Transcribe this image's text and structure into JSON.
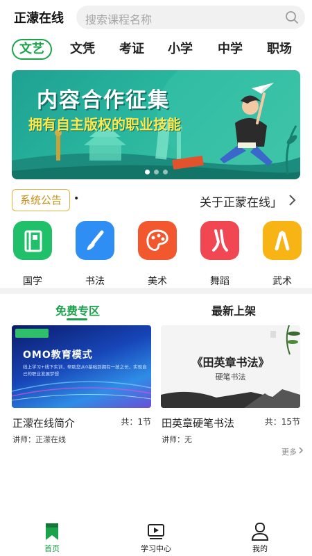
{
  "header": {
    "app_name": "正濛在线",
    "search_placeholder": "搜索课程名称"
  },
  "categories": [
    "文艺",
    "文凭",
    "考证",
    "小学",
    "中学",
    "职场"
  ],
  "active_category": "文艺",
  "banner": {
    "title": "内容合作征集",
    "subtitle": "拥有自主版权的职业技能",
    "slide_count": 3,
    "active_slide": 1
  },
  "notice": {
    "badge": "系统公告",
    "bullet": "•",
    "text": "关于正蒙在线」"
  },
  "subjects": [
    {
      "label": "国学",
      "icon": "book-icon",
      "color": "#20c06a"
    },
    {
      "label": "书法",
      "icon": "brush-icon",
      "color": "#2f8ef3"
    },
    {
      "label": "美术",
      "icon": "palette-icon",
      "color": "#f2572e"
    },
    {
      "label": "舞蹈",
      "icon": "ballet-shoes-icon",
      "color": "#f04752"
    },
    {
      "label": "武术",
      "icon": "nunchaku-icon",
      "color": "#f8b414"
    }
  ],
  "tabs": [
    "免费专区",
    "最新上架"
  ],
  "active_tab": "免费专区",
  "courses": [
    {
      "name": "正濛在线简介",
      "count": "共：1节",
      "teacher": "讲师：正濛在线",
      "thumb_title": "OMO教育模式",
      "thumb_desc": "线上学习+线下实训，帮助您从0基础到拥有一技之长，实现自己的职业发展梦想"
    },
    {
      "name": "田英章硬笔书法",
      "count": "共：15节",
      "teacher": "讲师：无",
      "thumb_title": "《田英章书法》",
      "thumb_sub": "硬笔书法"
    }
  ],
  "more_label": "更多",
  "bottom_nav": [
    {
      "label": "首页",
      "icon": "home-bookmark-icon"
    },
    {
      "label": "学习中心",
      "icon": "video-play-icon"
    },
    {
      "label": "我的",
      "icon": "user-icon"
    }
  ],
  "active_nav": "首页",
  "colors": {
    "accent": "#1aa34a",
    "notice": "#e2b23c",
    "banner_bg": "#29b79f"
  }
}
